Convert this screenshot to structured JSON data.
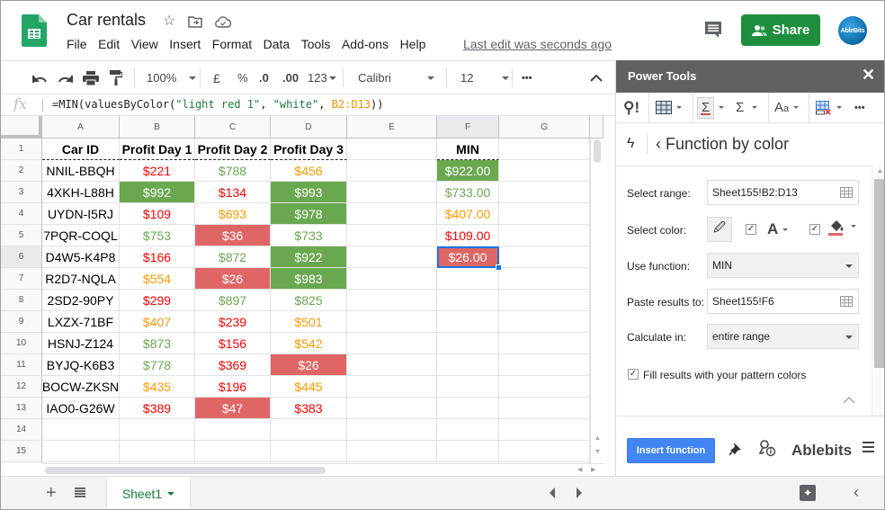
{
  "app": {
    "doc_title": "Car rentals",
    "menu": [
      "File",
      "Edit",
      "View",
      "Insert",
      "Format",
      "Data",
      "Tools",
      "Add-ons",
      "Help"
    ],
    "last_edit": "Last edit was seconds ago",
    "share_label": "Share",
    "avatar_label": "AbleBits",
    "title_icons": [
      "star-icon",
      "move-to-folder-icon",
      "cloud-saved-icon"
    ]
  },
  "toolbar": {
    "zoom": "100%",
    "currency": "£",
    "percent": "%",
    "decrease_decimals": ".0",
    "increase_decimals": ".00",
    "more_formats": "123",
    "font": "Calibri",
    "font_size": "12",
    "more": "•••"
  },
  "formula_bar": {
    "fx_label": "fx",
    "formula_prefix": "=MIN(valuesByColor(",
    "arg1": "\"light red 1\"",
    "sep1": ", ",
    "arg2": "\"white\"",
    "sep2": ", ",
    "arg3": "B2:D13",
    "formula_suffix": "))"
  },
  "colors": {
    "green_text": "#6aa84f",
    "red_text": "#ff0000",
    "orange_text": "#ff9900",
    "green_fill": "#6aa84f",
    "red_fill": "#e06666",
    "white_text": "#ffffff",
    "accent_blue": "#1a73e8",
    "share_green": "#1e8e3e"
  },
  "sheet": {
    "columns": [
      "A",
      "B",
      "C",
      "D",
      "E",
      "F",
      "G"
    ],
    "rows": [
      "1",
      "2",
      "3",
      "4",
      "5",
      "6",
      "7",
      "8",
      "9",
      "10",
      "11",
      "12",
      "13",
      "14",
      "15",
      ""
    ],
    "headers": [
      "Car ID",
      "Profit Day 1",
      "Profit Day 2",
      "Profit Day 3",
      "",
      "MIN"
    ],
    "data": [
      {
        "id": "NNIL-BBQH",
        "d1": {
          "v": "$221",
          "c": "red"
        },
        "d2": {
          "v": "$788",
          "c": "green"
        },
        "d3": {
          "v": "$456",
          "c": "orange"
        },
        "min": {
          "v": "$922.00",
          "c": "green-fill"
        }
      },
      {
        "id": "4XKH-L88H",
        "d1": {
          "v": "$992",
          "c": "green-fill"
        },
        "d2": {
          "v": "$134",
          "c": "red"
        },
        "d3": {
          "v": "$993",
          "c": "green-fill"
        },
        "min": {
          "v": "$733.00",
          "c": "green"
        }
      },
      {
        "id": "UYDN-I5RJ",
        "d1": {
          "v": "$109",
          "c": "red"
        },
        "d2": {
          "v": "$693",
          "c": "orange"
        },
        "d3": {
          "v": "$978",
          "c": "green-fill"
        },
        "min": {
          "v": "$407.00",
          "c": "orange"
        }
      },
      {
        "id": "7PQR-COQL",
        "d1": {
          "v": "$753",
          "c": "green"
        },
        "d2": {
          "v": "$36",
          "c": "red-fill"
        },
        "d3": {
          "v": "$733",
          "c": "green"
        },
        "min": {
          "v": "$109.00",
          "c": "red"
        }
      },
      {
        "id": "D4W5-K4P8",
        "d1": {
          "v": "$166",
          "c": "red"
        },
        "d2": {
          "v": "$872",
          "c": "green"
        },
        "d3": {
          "v": "$922",
          "c": "green-fill"
        },
        "min": {
          "v": "$26.00",
          "c": "red-fill"
        }
      },
      {
        "id": "R2D7-NQLA",
        "d1": {
          "v": "$554",
          "c": "orange"
        },
        "d2": {
          "v": "$26",
          "c": "red-fill"
        },
        "d3": {
          "v": "$983",
          "c": "green-fill"
        },
        "min": {
          "v": "",
          "c": ""
        }
      },
      {
        "id": "2SD2-90PY",
        "d1": {
          "v": "$299",
          "c": "red"
        },
        "d2": {
          "v": "$897",
          "c": "green"
        },
        "d3": {
          "v": "$825",
          "c": "green"
        },
        "min": {
          "v": "",
          "c": ""
        }
      },
      {
        "id": "LXZX-71BF",
        "d1": {
          "v": "$407",
          "c": "orange"
        },
        "d2": {
          "v": "$239",
          "c": "red"
        },
        "d3": {
          "v": "$501",
          "c": "orange"
        },
        "min": {
          "v": "",
          "c": ""
        }
      },
      {
        "id": "HSNJ-Z124",
        "d1": {
          "v": "$873",
          "c": "green"
        },
        "d2": {
          "v": "$156",
          "c": "red"
        },
        "d3": {
          "v": "$542",
          "c": "orange"
        },
        "min": {
          "v": "",
          "c": ""
        }
      },
      {
        "id": "BYJQ-K6B3",
        "d1": {
          "v": "$778",
          "c": "green"
        },
        "d2": {
          "v": "$369",
          "c": "red"
        },
        "d3": {
          "v": "$26",
          "c": "red-fill"
        },
        "min": {
          "v": "",
          "c": ""
        }
      },
      {
        "id": "BOCW-ZKSN",
        "d1": {
          "v": "$435",
          "c": "orange"
        },
        "d2": {
          "v": "$196",
          "c": "red"
        },
        "d3": {
          "v": "$445",
          "c": "orange"
        },
        "min": {
          "v": "",
          "c": ""
        }
      },
      {
        "id": "IAO0-G26W",
        "d1": {
          "v": "$389",
          "c": "red"
        },
        "d2": {
          "v": "$47",
          "c": "red-fill"
        },
        "d3": {
          "v": "$383",
          "c": "red"
        },
        "min": {
          "v": "",
          "c": ""
        }
      }
    ],
    "active_cell": "F6",
    "tab_name": "Sheet1"
  },
  "panel": {
    "title": "Power Tools",
    "close": "✕",
    "section_title": "Function by color",
    "select_range_label": "Select range:",
    "select_range_value": "Sheet155!B2:D13",
    "select_color_label": "Select color:",
    "font_color_checked": true,
    "fill_color_checked": true,
    "font_color_glyph": "A",
    "use_function_label": "Use function:",
    "use_function_value": "MIN",
    "paste_results_label": "Paste results to:",
    "paste_results_value": "Sheet155!F6",
    "calculate_in_label": "Calculate in:",
    "calculate_in_value": "entire range",
    "fill_results_label": "Fill results with your pattern colors",
    "fill_results_checked": true,
    "insert_button": "Insert function",
    "brand": "Ablebits"
  }
}
